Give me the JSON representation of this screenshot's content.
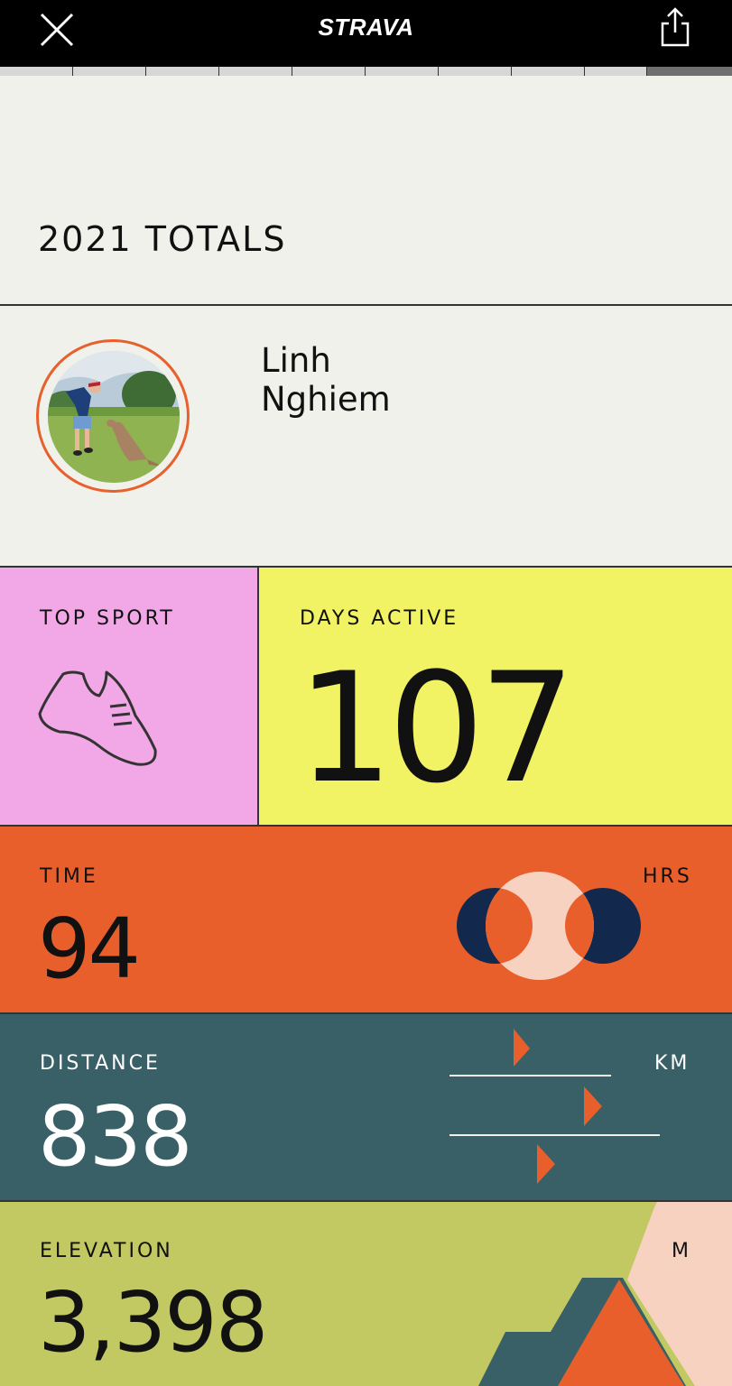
{
  "header": {
    "logo_text": "STRAVA",
    "close_icon": "close-icon",
    "share_icon": "share-icon",
    "progress": {
      "segments": 10,
      "active_index": 9
    }
  },
  "page": {
    "title": "2021 TOTALS"
  },
  "athlete": {
    "first_name": "Linh",
    "last_name": "Nghiem",
    "avatar_icon": "profile-photo"
  },
  "top_sport": {
    "label": "TOP SPORT",
    "icon": "running-shoe-icon",
    "color": "#f2a7e6"
  },
  "days_active": {
    "label": "DAYS ACTIVE",
    "value": "107",
    "color": "#f1f264"
  },
  "time": {
    "label": "TIME",
    "value": "94",
    "unit": "HRS",
    "color": "#e85f2b"
  },
  "distance": {
    "label": "DISTANCE",
    "value": "838",
    "unit": "KM",
    "color": "#386066"
  },
  "elevation": {
    "label": "ELEVATION",
    "value": "3,398",
    "unit": "M",
    "color": "#c2c963"
  }
}
